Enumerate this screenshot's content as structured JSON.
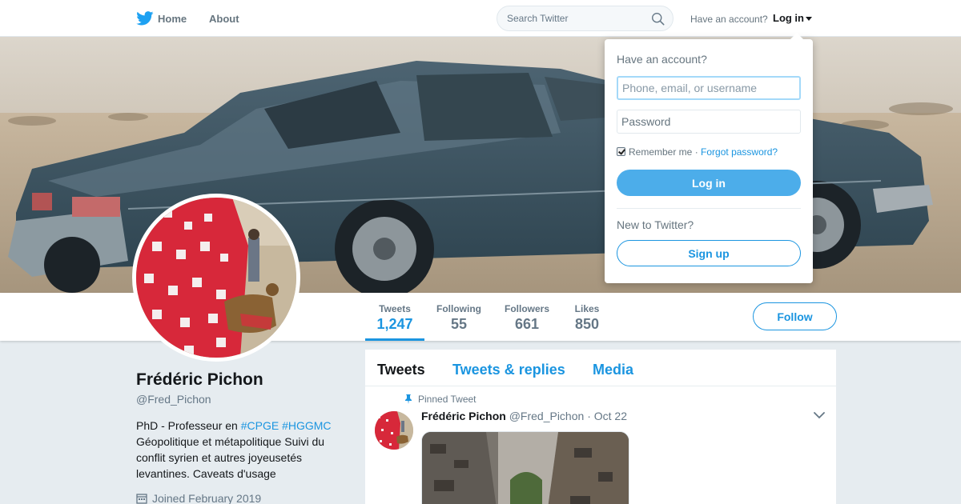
{
  "nav": {
    "home_label": "Home",
    "about_label": "About",
    "search_placeholder": "Search Twitter",
    "have_account": "Have an account?",
    "login_label": "Log in"
  },
  "profile": {
    "name": "Frédéric Pichon",
    "handle": "@Fred_Pichon",
    "bio_prefix": "PhD - Professeur en ",
    "bio_tag1": "#CPGE",
    "bio_tag2": "#HGGMC",
    "bio_rest": "Géopolitique et métapolitique Suivi du conflit syrien et autres joyeusetés levantines. Caveats d'usage",
    "joined": "Joined February 2019"
  },
  "stats": [
    {
      "label": "Tweets",
      "value": "1,247"
    },
    {
      "label": "Following",
      "value": "55"
    },
    {
      "label": "Followers",
      "value": "661"
    },
    {
      "label": "Likes",
      "value": "850"
    }
  ],
  "follow_label": "Follow",
  "timeline": {
    "tabs": [
      "Tweets",
      "Tweets & replies",
      "Media"
    ],
    "active_tab": "Tweets"
  },
  "tweet": {
    "pinned_label": "Pinned Tweet",
    "name": "Frédéric Pichon",
    "handle": "@Fred_Pichon",
    "separator": "·",
    "date": "Oct 22"
  },
  "login_dropdown": {
    "title": "Have an account?",
    "username_placeholder": "Phone, email, or username",
    "password_placeholder": "Password",
    "remember_label": "Remember me",
    "separator": "·",
    "forgot_label": "Forgot password?",
    "remember_checked": true,
    "login_button": "Log in",
    "new_label": "New to Twitter?",
    "signup_button": "Sign up"
  },
  "colors": {
    "accent": "#1b95e0",
    "login_button": "#4cadea",
    "background": "#e6ecf0"
  },
  "icons": [
    "twitter-bird-icon",
    "search-icon",
    "caret-down-icon",
    "calendar-icon",
    "pin-icon",
    "chevron-down-icon",
    "checkbox-icon"
  ]
}
